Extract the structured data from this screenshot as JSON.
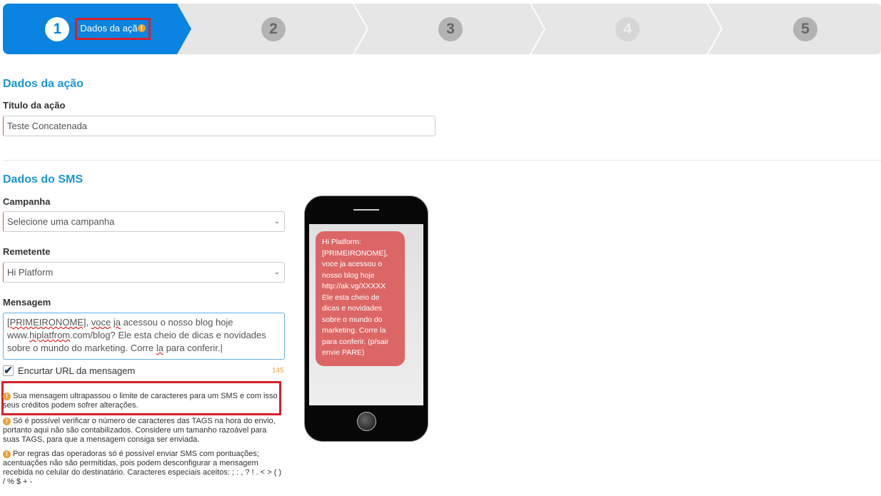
{
  "wizard": {
    "steps": [
      {
        "number": "1",
        "label": "Dados da açã",
        "active": true
      },
      {
        "number": "2"
      },
      {
        "number": "3"
      },
      {
        "number": "4",
        "disabled": true
      },
      {
        "number": "5"
      }
    ],
    "active_color": "#0a84e0"
  },
  "section_action": {
    "title": "Dados da ação",
    "title_label": "Título da ação",
    "title_value": "Teste Concatenada"
  },
  "section_sms": {
    "title": "Dados do SMS",
    "campaign_label": "Campanha",
    "campaign_value": "Selecione uma campanha",
    "sender_label": "Remetente",
    "sender_value": "Hi Platform",
    "message_label": "Mensagem",
    "message": {
      "w1": "[PRIMEIRONOME]",
      "t1": ", ",
      "w2": "voce",
      "t2": " ",
      "w3": "ja",
      "t3": " acessou o nosso blog hoje www.",
      "w4": "hiplatfrom",
      "t4": ".com/blog? Ele esta cheio de dicas e novidades sobre o mundo do marketing. Corre ",
      "w5": "la",
      "t5": " para conferir."
    },
    "shorten_label": "Encurtar URL da mensagem",
    "shorten_checked": true,
    "char_count": "145",
    "notes": [
      "Sua mensagem ultrapassou o limite de caracteres para um SMS e com isso seus créditos podem sofrer alterações.",
      "Só é possível verificar o número de caracteres das TAGS na hora do envio, portanto aqui não são contabilizados. Considere um tamanho razoável para suas TAGS, para que a mensagem consiga ser enviada.",
      "Por regras das operadoras só é possível enviar SMS com pontuações; acentuações não são permitidas, pois podem desconfigurar a mensagem recebida no celular do destinatário. Caracteres especiais aceitos: ; : , ? ! . < > ( ) / % $ + -"
    ]
  },
  "preview": {
    "sms_text": "Hi Platform: [PRIMEIRONOME], voce ja acessou o nosso blog hoje http://ak.vg/XXXXX Ele esta cheio de dicas e novidades sobre o mundo do marketing. Corre la para conferir. (p/sair envie PARE)"
  }
}
